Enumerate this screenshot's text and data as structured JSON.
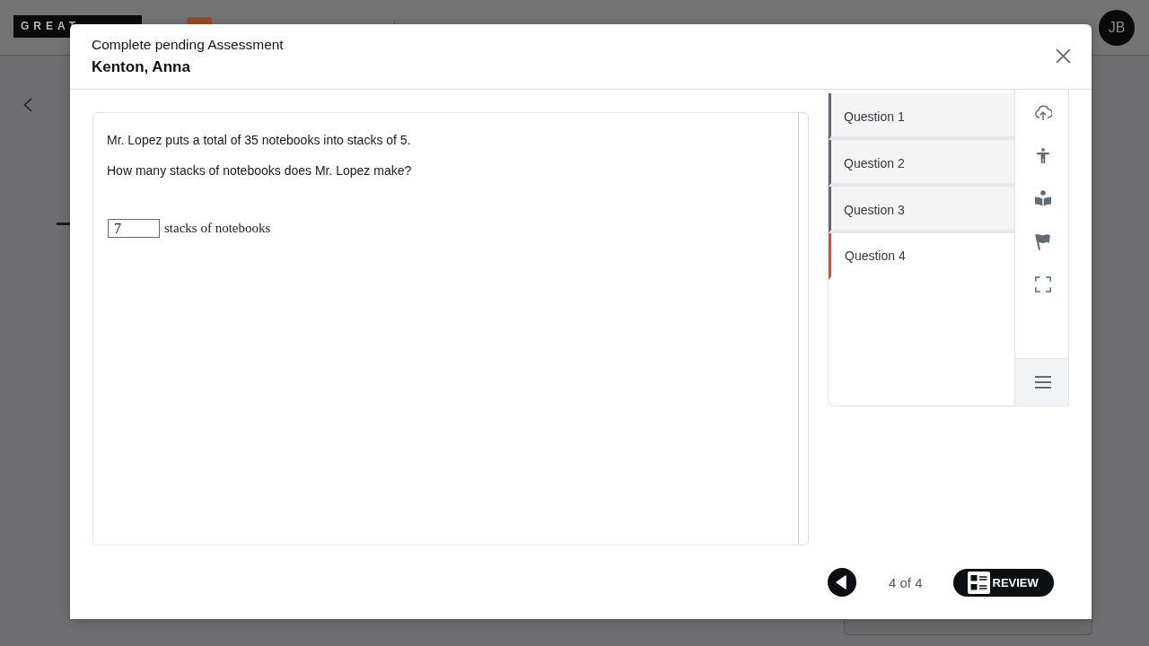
{
  "background": {
    "logo": "GREAT",
    "avatar": "JB"
  },
  "dialog": {
    "title": "Complete pending Assessment",
    "student": "Kenton, Anna"
  },
  "question": {
    "paragraphs": [
      "Mr. Lopez puts a total of 35 notebooks into stacks of 5.",
      "How many stacks of notebooks does Mr. Lopez make?"
    ],
    "answer": {
      "value": "7",
      "unit": "stacks of notebooks"
    }
  },
  "questions": [
    {
      "label": "Question 1",
      "selected": false
    },
    {
      "label": "Question 2",
      "selected": false
    },
    {
      "label": "Question 3",
      "selected": false
    },
    {
      "label": "Question 4",
      "selected": true
    }
  ],
  "footer": {
    "position": "4 of 4",
    "review_button": "REVIEW"
  }
}
